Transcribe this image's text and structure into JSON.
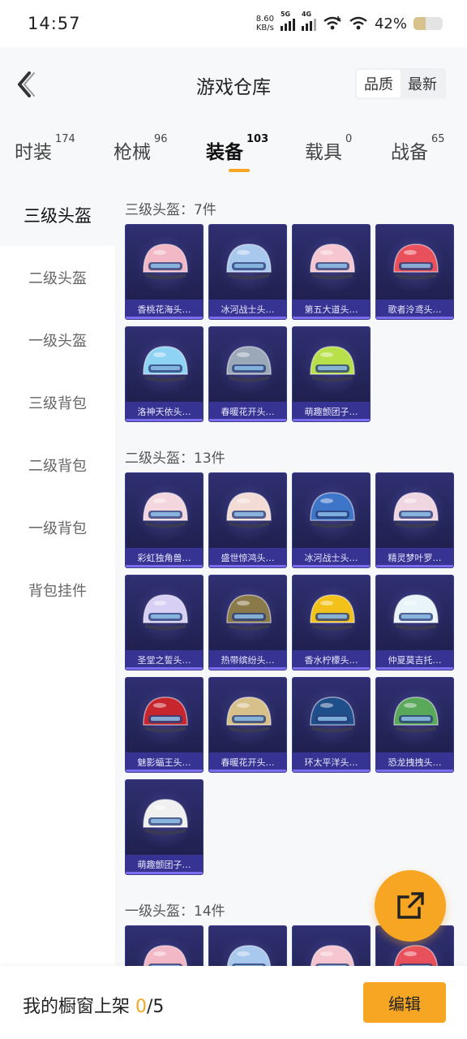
{
  "status_bar": {
    "time": "14:57",
    "net_speed_value": "8.60",
    "net_speed_unit": "KB/s",
    "signal1_label": "5G",
    "signal2_label": "4G",
    "battery_pct": "42%",
    "battery_level": 0.42
  },
  "header": {
    "title": "游戏仓库",
    "sort_quality": "品质",
    "sort_latest": "最新"
  },
  "tabs": [
    {
      "label": "时装",
      "count": "174"
    },
    {
      "label": "枪械",
      "count": "96"
    },
    {
      "label": "装备",
      "count": "103"
    },
    {
      "label": "载具",
      "count": "0"
    },
    {
      "label": "战备",
      "count": "65"
    }
  ],
  "sidebar": [
    "三级头盔",
    "二级头盔",
    "一级头盔",
    "三级背包",
    "二级背包",
    "一级背包",
    "背包挂件"
  ],
  "sections": [
    {
      "title": "三级头盔：7件",
      "items": [
        "香桃花海头…",
        "冰河战士头…",
        "第五大道头…",
        "歌者泠鸢头…",
        "洛神天依头…",
        "春暖花开头…",
        "萌趣颤团子…"
      ]
    },
    {
      "title": "二级头盔：13件",
      "items": [
        "彩虹独角兽…",
        "盛世惊鸿头…",
        "冰河战士头…",
        "精灵梦叶罗…",
        "圣堂之誓头…",
        "热带缤纷头…",
        "香水柠檬头…",
        "仲夏莫吉托…",
        "魅影蝠王头…",
        "春暖花开头…",
        "环太平洋头…",
        "恐龙拽拽头…",
        "萌趣颤团子…"
      ]
    },
    {
      "title": "一级头盔：14件",
      "items": [
        "",
        "",
        "",
        ""
      ]
    }
  ],
  "colors": {
    "accent": "#f6a623",
    "card_top": "#2f2f72",
    "card_bottom": "#1c1d48",
    "label_bg": "#3c37a0"
  },
  "bottom_bar": {
    "prefix": "我的橱窗上架 ",
    "count": "0",
    "total": "/5",
    "edit_label": "编辑"
  },
  "icons": {
    "back": "chevron-left-icon",
    "share": "share-external-icon"
  }
}
